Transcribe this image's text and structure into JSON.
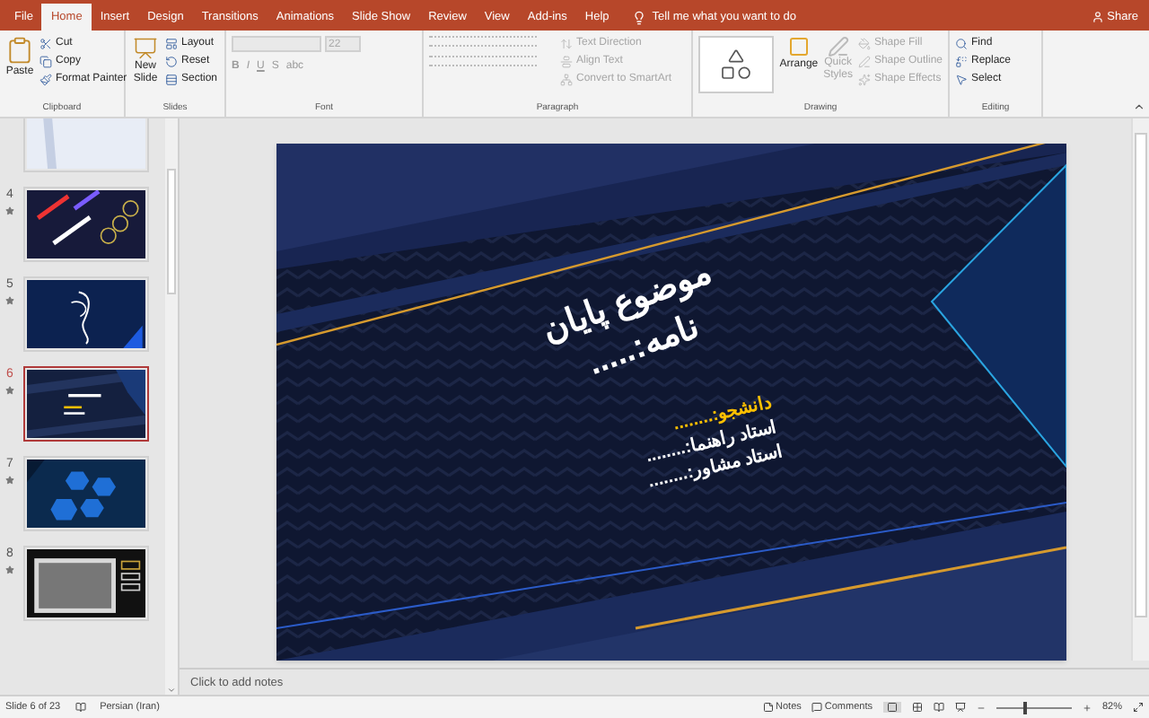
{
  "tabs": [
    {
      "label": "File",
      "selected": false
    },
    {
      "label": "Home",
      "selected": true
    },
    {
      "label": "Insert",
      "selected": false
    },
    {
      "label": "Design",
      "selected": false
    },
    {
      "label": "Transitions",
      "selected": false
    },
    {
      "label": "Animations",
      "selected": false
    },
    {
      "label": "Slide Show",
      "selected": false
    },
    {
      "label": "Review",
      "selected": false
    },
    {
      "label": "View",
      "selected": false
    },
    {
      "label": "Add-ins",
      "selected": false
    },
    {
      "label": "Help",
      "selected": false
    }
  ],
  "tell_me": "Tell me what you want to do",
  "share": "Share",
  "ribbon": {
    "clipboard": {
      "label": "Clipboard",
      "paste": "Paste",
      "items": [
        {
          "label": "Cut",
          "disabled": false
        },
        {
          "label": "Copy",
          "disabled": false
        },
        {
          "label": "Format Painter",
          "disabled": false
        }
      ]
    },
    "slides": {
      "label": "Slides",
      "new_slide": "New Slide",
      "items": [
        {
          "label": "Layout",
          "disabled": false
        },
        {
          "label": "Reset",
          "disabled": false
        },
        {
          "label": "Section",
          "disabled": false
        }
      ]
    },
    "font": {
      "label": "Font",
      "size": "22",
      "buttons": [
        "B",
        "I",
        "U",
        "S",
        "abc"
      ]
    },
    "paragraph": {
      "label": "Paragraph",
      "items": [
        {
          "label": "Text Direction",
          "disabled": true
        },
        {
          "label": "Align Text",
          "disabled": true
        },
        {
          "label": "Convert to SmartArt",
          "disabled": true
        }
      ]
    },
    "drawing": {
      "label": "Drawing",
      "arrange": "Arrange",
      "quick_styles": "Quick Styles",
      "items": [
        {
          "label": "Shape Fill",
          "disabled": true
        },
        {
          "label": "Shape Outline",
          "disabled": true
        },
        {
          "label": "Shape Effects",
          "disabled": true
        }
      ]
    },
    "editing": {
      "label": "Editing",
      "items": [
        {
          "label": "Find",
          "disabled": false
        },
        {
          "label": "Replace",
          "disabled": false
        },
        {
          "label": "Select",
          "disabled": false
        }
      ]
    }
  },
  "thumbnails": [
    {
      "selected": false
    },
    {
      "number": "4",
      "selected": false
    },
    {
      "number": "5",
      "selected": false
    },
    {
      "number": "6",
      "selected": true
    },
    {
      "number": "7",
      "selected": false
    },
    {
      "number": "8",
      "selected": false
    }
  ],
  "slide": {
    "title": "موضوع پایان نامه:.....",
    "lines": [
      {
        "text": "دانشجو:........",
        "color": "#ffc000"
      },
      {
        "text": "استاد راهنما:........",
        "color": "#ffffff"
      },
      {
        "text": "استاد مشاور:........",
        "color": "#ffffff"
      }
    ]
  },
  "notes_placeholder": "Click to add notes",
  "status_bar": {
    "slide": "Slide 6 of 23",
    "language": "Persian (Iran)",
    "notes": "Notes",
    "comments": "Comments",
    "zoom": "82%",
    "zoom_slider": {
      "level": 0.36
    }
  }
}
